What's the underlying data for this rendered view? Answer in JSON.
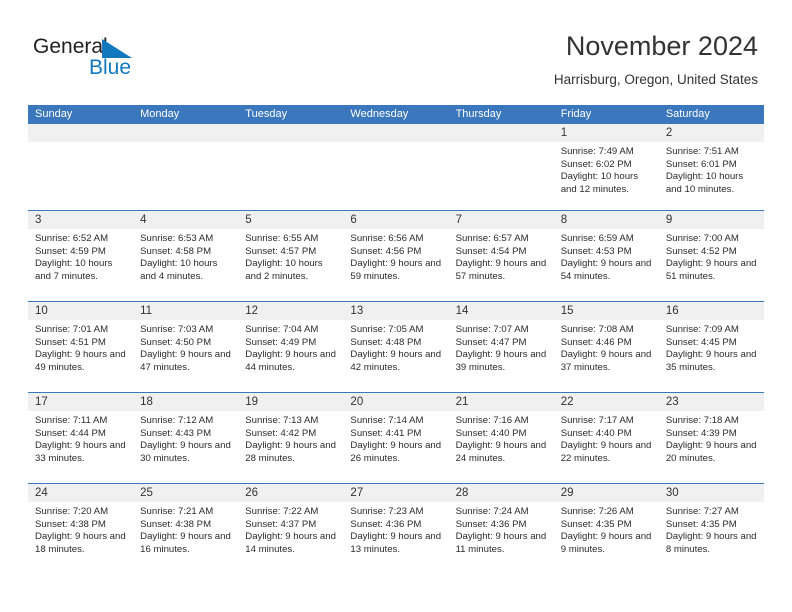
{
  "brand": {
    "name_part1": "General",
    "name_part2": "Blue",
    "logo_icon": "triangle-logo-icon",
    "color_primary": "#1278be",
    "color_text": "#231f20"
  },
  "header": {
    "title": "November 2024",
    "location": "Harrisburg, Oregon, United States"
  },
  "theme": {
    "header_bar_color": "#3a77bd",
    "day_band_color": "#f0f0f0",
    "row_divider_color": "#3a77bd"
  },
  "calendar": {
    "weekdays": [
      "Sunday",
      "Monday",
      "Tuesday",
      "Wednesday",
      "Thursday",
      "Friday",
      "Saturday"
    ],
    "weeks": [
      [
        {
          "day": "",
          "empty": true
        },
        {
          "day": "",
          "empty": true
        },
        {
          "day": "",
          "empty": true
        },
        {
          "day": "",
          "empty": true
        },
        {
          "day": "",
          "empty": true
        },
        {
          "day": "1",
          "sunrise": "Sunrise: 7:49 AM",
          "sunset": "Sunset: 6:02 PM",
          "daylight": "Daylight: 10 hours and 12 minutes."
        },
        {
          "day": "2",
          "sunrise": "Sunrise: 7:51 AM",
          "sunset": "Sunset: 6:01 PM",
          "daylight": "Daylight: 10 hours and 10 minutes."
        }
      ],
      [
        {
          "day": "3",
          "sunrise": "Sunrise: 6:52 AM",
          "sunset": "Sunset: 4:59 PM",
          "daylight": "Daylight: 10 hours and 7 minutes."
        },
        {
          "day": "4",
          "sunrise": "Sunrise: 6:53 AM",
          "sunset": "Sunset: 4:58 PM",
          "daylight": "Daylight: 10 hours and 4 minutes."
        },
        {
          "day": "5",
          "sunrise": "Sunrise: 6:55 AM",
          "sunset": "Sunset: 4:57 PM",
          "daylight": "Daylight: 10 hours and 2 minutes."
        },
        {
          "day": "6",
          "sunrise": "Sunrise: 6:56 AM",
          "sunset": "Sunset: 4:56 PM",
          "daylight": "Daylight: 9 hours and 59 minutes."
        },
        {
          "day": "7",
          "sunrise": "Sunrise: 6:57 AM",
          "sunset": "Sunset: 4:54 PM",
          "daylight": "Daylight: 9 hours and 57 minutes."
        },
        {
          "day": "8",
          "sunrise": "Sunrise: 6:59 AM",
          "sunset": "Sunset: 4:53 PM",
          "daylight": "Daylight: 9 hours and 54 minutes."
        },
        {
          "day": "9",
          "sunrise": "Sunrise: 7:00 AM",
          "sunset": "Sunset: 4:52 PM",
          "daylight": "Daylight: 9 hours and 51 minutes."
        }
      ],
      [
        {
          "day": "10",
          "sunrise": "Sunrise: 7:01 AM",
          "sunset": "Sunset: 4:51 PM",
          "daylight": "Daylight: 9 hours and 49 minutes."
        },
        {
          "day": "11",
          "sunrise": "Sunrise: 7:03 AM",
          "sunset": "Sunset: 4:50 PM",
          "daylight": "Daylight: 9 hours and 47 minutes."
        },
        {
          "day": "12",
          "sunrise": "Sunrise: 7:04 AM",
          "sunset": "Sunset: 4:49 PM",
          "daylight": "Daylight: 9 hours and 44 minutes."
        },
        {
          "day": "13",
          "sunrise": "Sunrise: 7:05 AM",
          "sunset": "Sunset: 4:48 PM",
          "daylight": "Daylight: 9 hours and 42 minutes."
        },
        {
          "day": "14",
          "sunrise": "Sunrise: 7:07 AM",
          "sunset": "Sunset: 4:47 PM",
          "daylight": "Daylight: 9 hours and 39 minutes."
        },
        {
          "day": "15",
          "sunrise": "Sunrise: 7:08 AM",
          "sunset": "Sunset: 4:46 PM",
          "daylight": "Daylight: 9 hours and 37 minutes."
        },
        {
          "day": "16",
          "sunrise": "Sunrise: 7:09 AM",
          "sunset": "Sunset: 4:45 PM",
          "daylight": "Daylight: 9 hours and 35 minutes."
        }
      ],
      [
        {
          "day": "17",
          "sunrise": "Sunrise: 7:11 AM",
          "sunset": "Sunset: 4:44 PM",
          "daylight": "Daylight: 9 hours and 33 minutes."
        },
        {
          "day": "18",
          "sunrise": "Sunrise: 7:12 AM",
          "sunset": "Sunset: 4:43 PM",
          "daylight": "Daylight: 9 hours and 30 minutes."
        },
        {
          "day": "19",
          "sunrise": "Sunrise: 7:13 AM",
          "sunset": "Sunset: 4:42 PM",
          "daylight": "Daylight: 9 hours and 28 minutes."
        },
        {
          "day": "20",
          "sunrise": "Sunrise: 7:14 AM",
          "sunset": "Sunset: 4:41 PM",
          "daylight": "Daylight: 9 hours and 26 minutes."
        },
        {
          "day": "21",
          "sunrise": "Sunrise: 7:16 AM",
          "sunset": "Sunset: 4:40 PM",
          "daylight": "Daylight: 9 hours and 24 minutes."
        },
        {
          "day": "22",
          "sunrise": "Sunrise: 7:17 AM",
          "sunset": "Sunset: 4:40 PM",
          "daylight": "Daylight: 9 hours and 22 minutes."
        },
        {
          "day": "23",
          "sunrise": "Sunrise: 7:18 AM",
          "sunset": "Sunset: 4:39 PM",
          "daylight": "Daylight: 9 hours and 20 minutes."
        }
      ],
      [
        {
          "day": "24",
          "sunrise": "Sunrise: 7:20 AM",
          "sunset": "Sunset: 4:38 PM",
          "daylight": "Daylight: 9 hours and 18 minutes."
        },
        {
          "day": "25",
          "sunrise": "Sunrise: 7:21 AM",
          "sunset": "Sunset: 4:38 PM",
          "daylight": "Daylight: 9 hours and 16 minutes."
        },
        {
          "day": "26",
          "sunrise": "Sunrise: 7:22 AM",
          "sunset": "Sunset: 4:37 PM",
          "daylight": "Daylight: 9 hours and 14 minutes."
        },
        {
          "day": "27",
          "sunrise": "Sunrise: 7:23 AM",
          "sunset": "Sunset: 4:36 PM",
          "daylight": "Daylight: 9 hours and 13 minutes."
        },
        {
          "day": "28",
          "sunrise": "Sunrise: 7:24 AM",
          "sunset": "Sunset: 4:36 PM",
          "daylight": "Daylight: 9 hours and 11 minutes."
        },
        {
          "day": "29",
          "sunrise": "Sunrise: 7:26 AM",
          "sunset": "Sunset: 4:35 PM",
          "daylight": "Daylight: 9 hours and 9 minutes."
        },
        {
          "day": "30",
          "sunrise": "Sunrise: 7:27 AM",
          "sunset": "Sunset: 4:35 PM",
          "daylight": "Daylight: 9 hours and 8 minutes."
        }
      ]
    ]
  }
}
